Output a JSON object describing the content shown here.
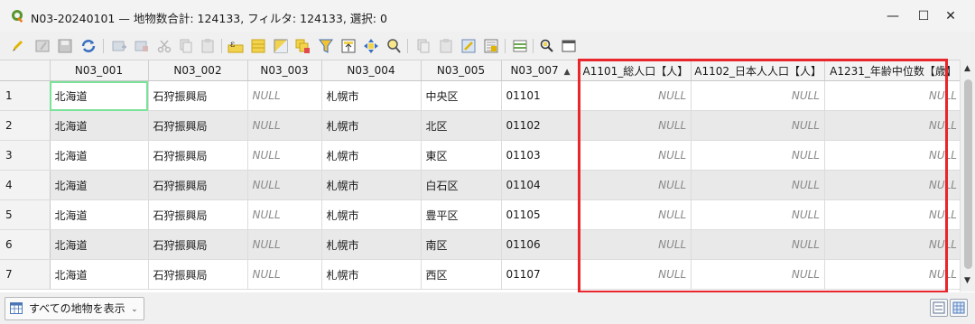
{
  "window": {
    "title": "N03-20240101 — 地物数合計: 124133, フィルタ: 124133, 選択: 0",
    "minimize_glyph": "—",
    "maximize_glyph": "☐",
    "close_glyph": "✕"
  },
  "toolbar": {
    "icons": [
      "pencil-icon",
      "multi-edit-icon",
      "save-edits-icon",
      "reload-icon",
      "add-feature-icon",
      "delete-feature-icon",
      "cut-icon",
      "copy-icon",
      "paste-icon",
      "expression-select-icon",
      "select-all-icon",
      "invert-selection-icon",
      "deselect-icon",
      "filter-selection-icon",
      "move-selection-top-icon",
      "pan-to-selection-icon",
      "zoom-to-selection-icon",
      "copy-rows-icon",
      "paste-rows-icon",
      "new-field-icon",
      "delete-field-icon",
      "field-calculator-icon",
      "conditional-formatting-icon",
      "actions-icon",
      "dock-icon"
    ]
  },
  "table": {
    "columns": [
      "N03_001",
      "N03_002",
      "N03_003",
      "N03_004",
      "N03_005",
      "N03_007",
      "A1101_総人口【人】",
      "A1102_日本人人口【人】",
      "A1231_年齢中位数【歳】"
    ],
    "rows": [
      {
        "id": "1",
        "N03_001": "北海道",
        "N03_002": "石狩振興局",
        "N03_003": "NULL",
        "N03_004": "札幌市",
        "N03_005": "中央区",
        "N03_007": "01101",
        "A1101": "NULL",
        "A1102": "NULL",
        "A1231": "NULL"
      },
      {
        "id": "2",
        "N03_001": "北海道",
        "N03_002": "石狩振興局",
        "N03_003": "NULL",
        "N03_004": "札幌市",
        "N03_005": "北区",
        "N03_007": "01102",
        "A1101": "NULL",
        "A1102": "NULL",
        "A1231": "NULL"
      },
      {
        "id": "3",
        "N03_001": "北海道",
        "N03_002": "石狩振興局",
        "N03_003": "NULL",
        "N03_004": "札幌市",
        "N03_005": "東区",
        "N03_007": "01103",
        "A1101": "NULL",
        "A1102": "NULL",
        "A1231": "NULL"
      },
      {
        "id": "4",
        "N03_001": "北海道",
        "N03_002": "石狩振興局",
        "N03_003": "NULL",
        "N03_004": "札幌市",
        "N03_005": "白石区",
        "N03_007": "01104",
        "A1101": "NULL",
        "A1102": "NULL",
        "A1231": "NULL"
      },
      {
        "id": "5",
        "N03_001": "北海道",
        "N03_002": "石狩振興局",
        "N03_003": "NULL",
        "N03_004": "札幌市",
        "N03_005": "豊平区",
        "N03_007": "01105",
        "A1101": "NULL",
        "A1102": "NULL",
        "A1231": "NULL"
      },
      {
        "id": "6",
        "N03_001": "北海道",
        "N03_002": "石狩振興局",
        "N03_003": "NULL",
        "N03_004": "札幌市",
        "N03_005": "南区",
        "N03_007": "01106",
        "A1101": "NULL",
        "A1102": "NULL",
        "A1231": "NULL"
      },
      {
        "id": "7",
        "N03_001": "北海道",
        "N03_002": "石狩振興局",
        "N03_003": "NULL",
        "N03_004": "札幌市",
        "N03_005": "西区",
        "N03_007": "01107",
        "A1101": "NULL",
        "A1102": "NULL",
        "A1231": "NULL"
      }
    ]
  },
  "bottombar": {
    "filter_label": "すべての地物を表示"
  },
  "colors": {
    "highlight": "#e8262b",
    "selected_cell_outline": "#7be29a",
    "alt_row": "#e9e9e9"
  }
}
